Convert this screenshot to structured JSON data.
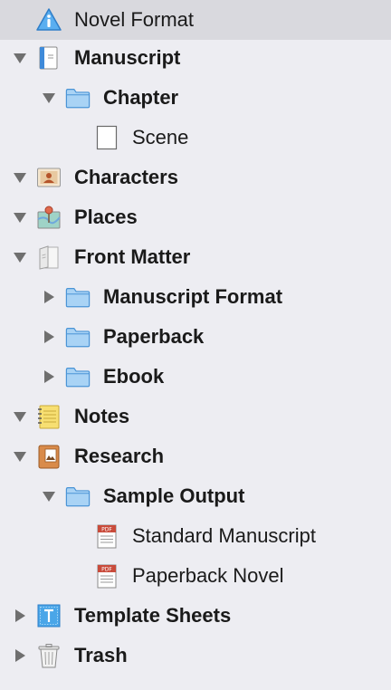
{
  "binder": {
    "items": [
      {
        "label": "Novel Format",
        "icon": "info-icon",
        "bold": false,
        "disclosure": "none",
        "selected": true
      },
      {
        "label": "Manuscript",
        "icon": "manuscript-book-icon",
        "bold": true,
        "disclosure": "expanded"
      },
      {
        "label": "Chapter",
        "icon": "folder-icon",
        "bold": true,
        "disclosure": "expanded"
      },
      {
        "label": "Scene",
        "icon": "blank-document-icon",
        "bold": false,
        "disclosure": "none"
      },
      {
        "label": "Characters",
        "icon": "character-card-icon",
        "bold": true,
        "disclosure": "expanded"
      },
      {
        "label": "Places",
        "icon": "map-pin-icon",
        "bold": true,
        "disclosure": "expanded"
      },
      {
        "label": "Front Matter",
        "icon": "front-matter-icon",
        "bold": true,
        "disclosure": "expanded"
      },
      {
        "label": "Manuscript Format",
        "icon": "folder-icon",
        "bold": true,
        "disclosure": "collapsed"
      },
      {
        "label": "Paperback",
        "icon": "folder-icon",
        "bold": true,
        "disclosure": "collapsed"
      },
      {
        "label": "Ebook",
        "icon": "folder-icon",
        "bold": true,
        "disclosure": "collapsed"
      },
      {
        "label": "Notes",
        "icon": "notepad-icon",
        "bold": true,
        "disclosure": "expanded"
      },
      {
        "label": "Research",
        "icon": "research-book-icon",
        "bold": true,
        "disclosure": "expanded"
      },
      {
        "label": "Sample Output",
        "icon": "folder-icon",
        "bold": true,
        "disclosure": "expanded"
      },
      {
        "label": "Standard Manuscript",
        "icon": "pdf-file-icon",
        "bold": false,
        "disclosure": "none"
      },
      {
        "label": "Paperback Novel",
        "icon": "pdf-file-icon",
        "bold": false,
        "disclosure": "none"
      },
      {
        "label": "Template Sheets",
        "icon": "template-sheet-icon",
        "bold": true,
        "disclosure": "collapsed"
      },
      {
        "label": "Trash",
        "icon": "trash-icon",
        "bold": true,
        "disclosure": "collapsed"
      }
    ]
  },
  "colors": {
    "background": "#ededf2",
    "selected_row": "#d9d9de",
    "folder_fill": "#a9d3f5",
    "folder_stroke": "#4a94d6",
    "disclosure": "#6f6f6f",
    "pdf_red": "#c94b3b"
  }
}
